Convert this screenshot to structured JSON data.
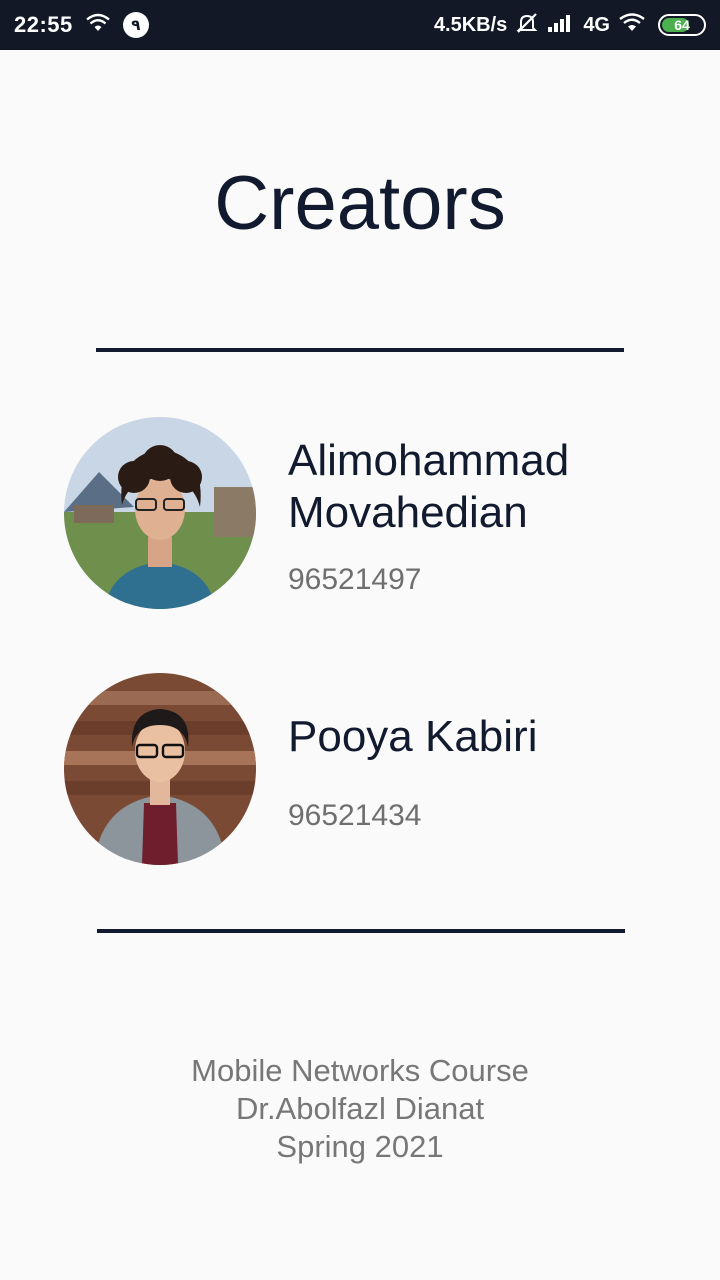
{
  "status_bar": {
    "time": "22:55",
    "notification_count": "٩",
    "network_speed": "4.5KB/s",
    "network_type": "4G",
    "battery_level": "64",
    "icons": [
      "wifi-icon",
      "notification-badge",
      "mute-icon",
      "signal-icon",
      "wifi-icon",
      "battery-icon"
    ]
  },
  "page": {
    "title": "Creators"
  },
  "creators": [
    {
      "name_line1": "Alimohammad",
      "name_line2": "Movahedian",
      "student_id": "96521497"
    },
    {
      "name": "Pooya Kabiri",
      "student_id": "96521434"
    }
  ],
  "footer": {
    "course": "Mobile Networks Course",
    "instructor": "Dr.Abolfazl Dianat",
    "term": "Spring 2021"
  },
  "colors": {
    "status_bar_bg": "#121826",
    "background": "#fafafa",
    "title_text": "#111a2e",
    "secondary_text": "#6f6f6f",
    "battery_fill": "#4caf50"
  }
}
